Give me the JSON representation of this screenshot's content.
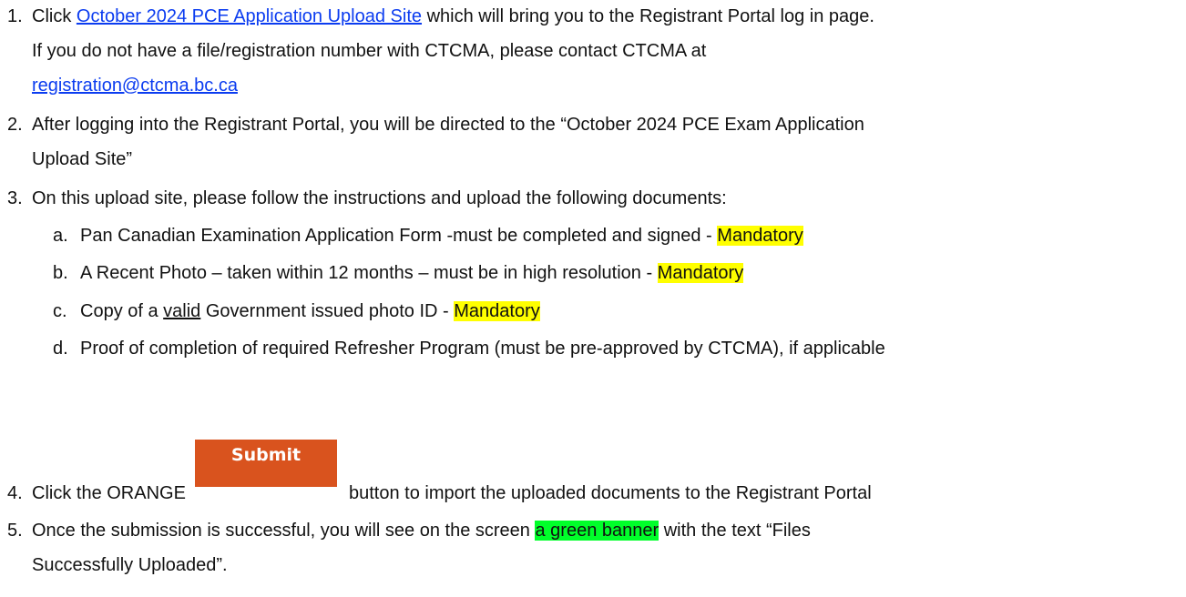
{
  "steps": {
    "s1": {
      "num": "1.",
      "pre": "Click ",
      "link": "October 2024 PCE Application Upload Site",
      "post": " which will bring you to the Registrant Portal log in page.",
      "line2": "If you do not have a file/registration number with CTCMA, please contact CTCMA at",
      "email": "registration@ctcma.bc.ca"
    },
    "s2": {
      "num": "2.",
      "line1": "After logging into the Registrant Portal, you will be directed to the “October 2024 PCE Exam Application",
      "line2": "Upload Site”"
    },
    "s3": {
      "num": "3.",
      "text": "On this upload site, please follow the instructions and upload the following documents:",
      "items": {
        "a": {
          "letter": "a.",
          "text": "Pan Canadian Examination Application Form -must be completed and signed - ",
          "badge": "Mandatory"
        },
        "b": {
          "letter": "b.",
          "text": "A Recent Photo – taken within 12 months – must be in high resolution - ",
          "badge": "Mandatory"
        },
        "c": {
          "letter": "c.",
          "pre": "Copy of a ",
          "underlined": "valid",
          "post": " Government issued photo ID - ",
          "badge": "Mandatory"
        },
        "d": {
          "letter": "d.",
          "text": "Proof of completion of required Refresher Program (must be pre-approved by CTCMA), if applicable"
        }
      }
    },
    "s4": {
      "num": "4.",
      "pre": "Click the ORANGE",
      "button": "Submit",
      "post": "button to import the uploaded documents to the Registrant Portal"
    },
    "s5": {
      "num": "5.",
      "pre": "Once the submission is successful, you will see on the screen ",
      "highlight": "a green banner",
      "post": " with the text “Files",
      "line2": "Successfully Uploaded”."
    }
  },
  "colors": {
    "link": "#0b3cf0",
    "submit_button": "#d9531e",
    "mandatory_highlight": "#ffff00",
    "banner_highlight": "#00ff2a"
  }
}
